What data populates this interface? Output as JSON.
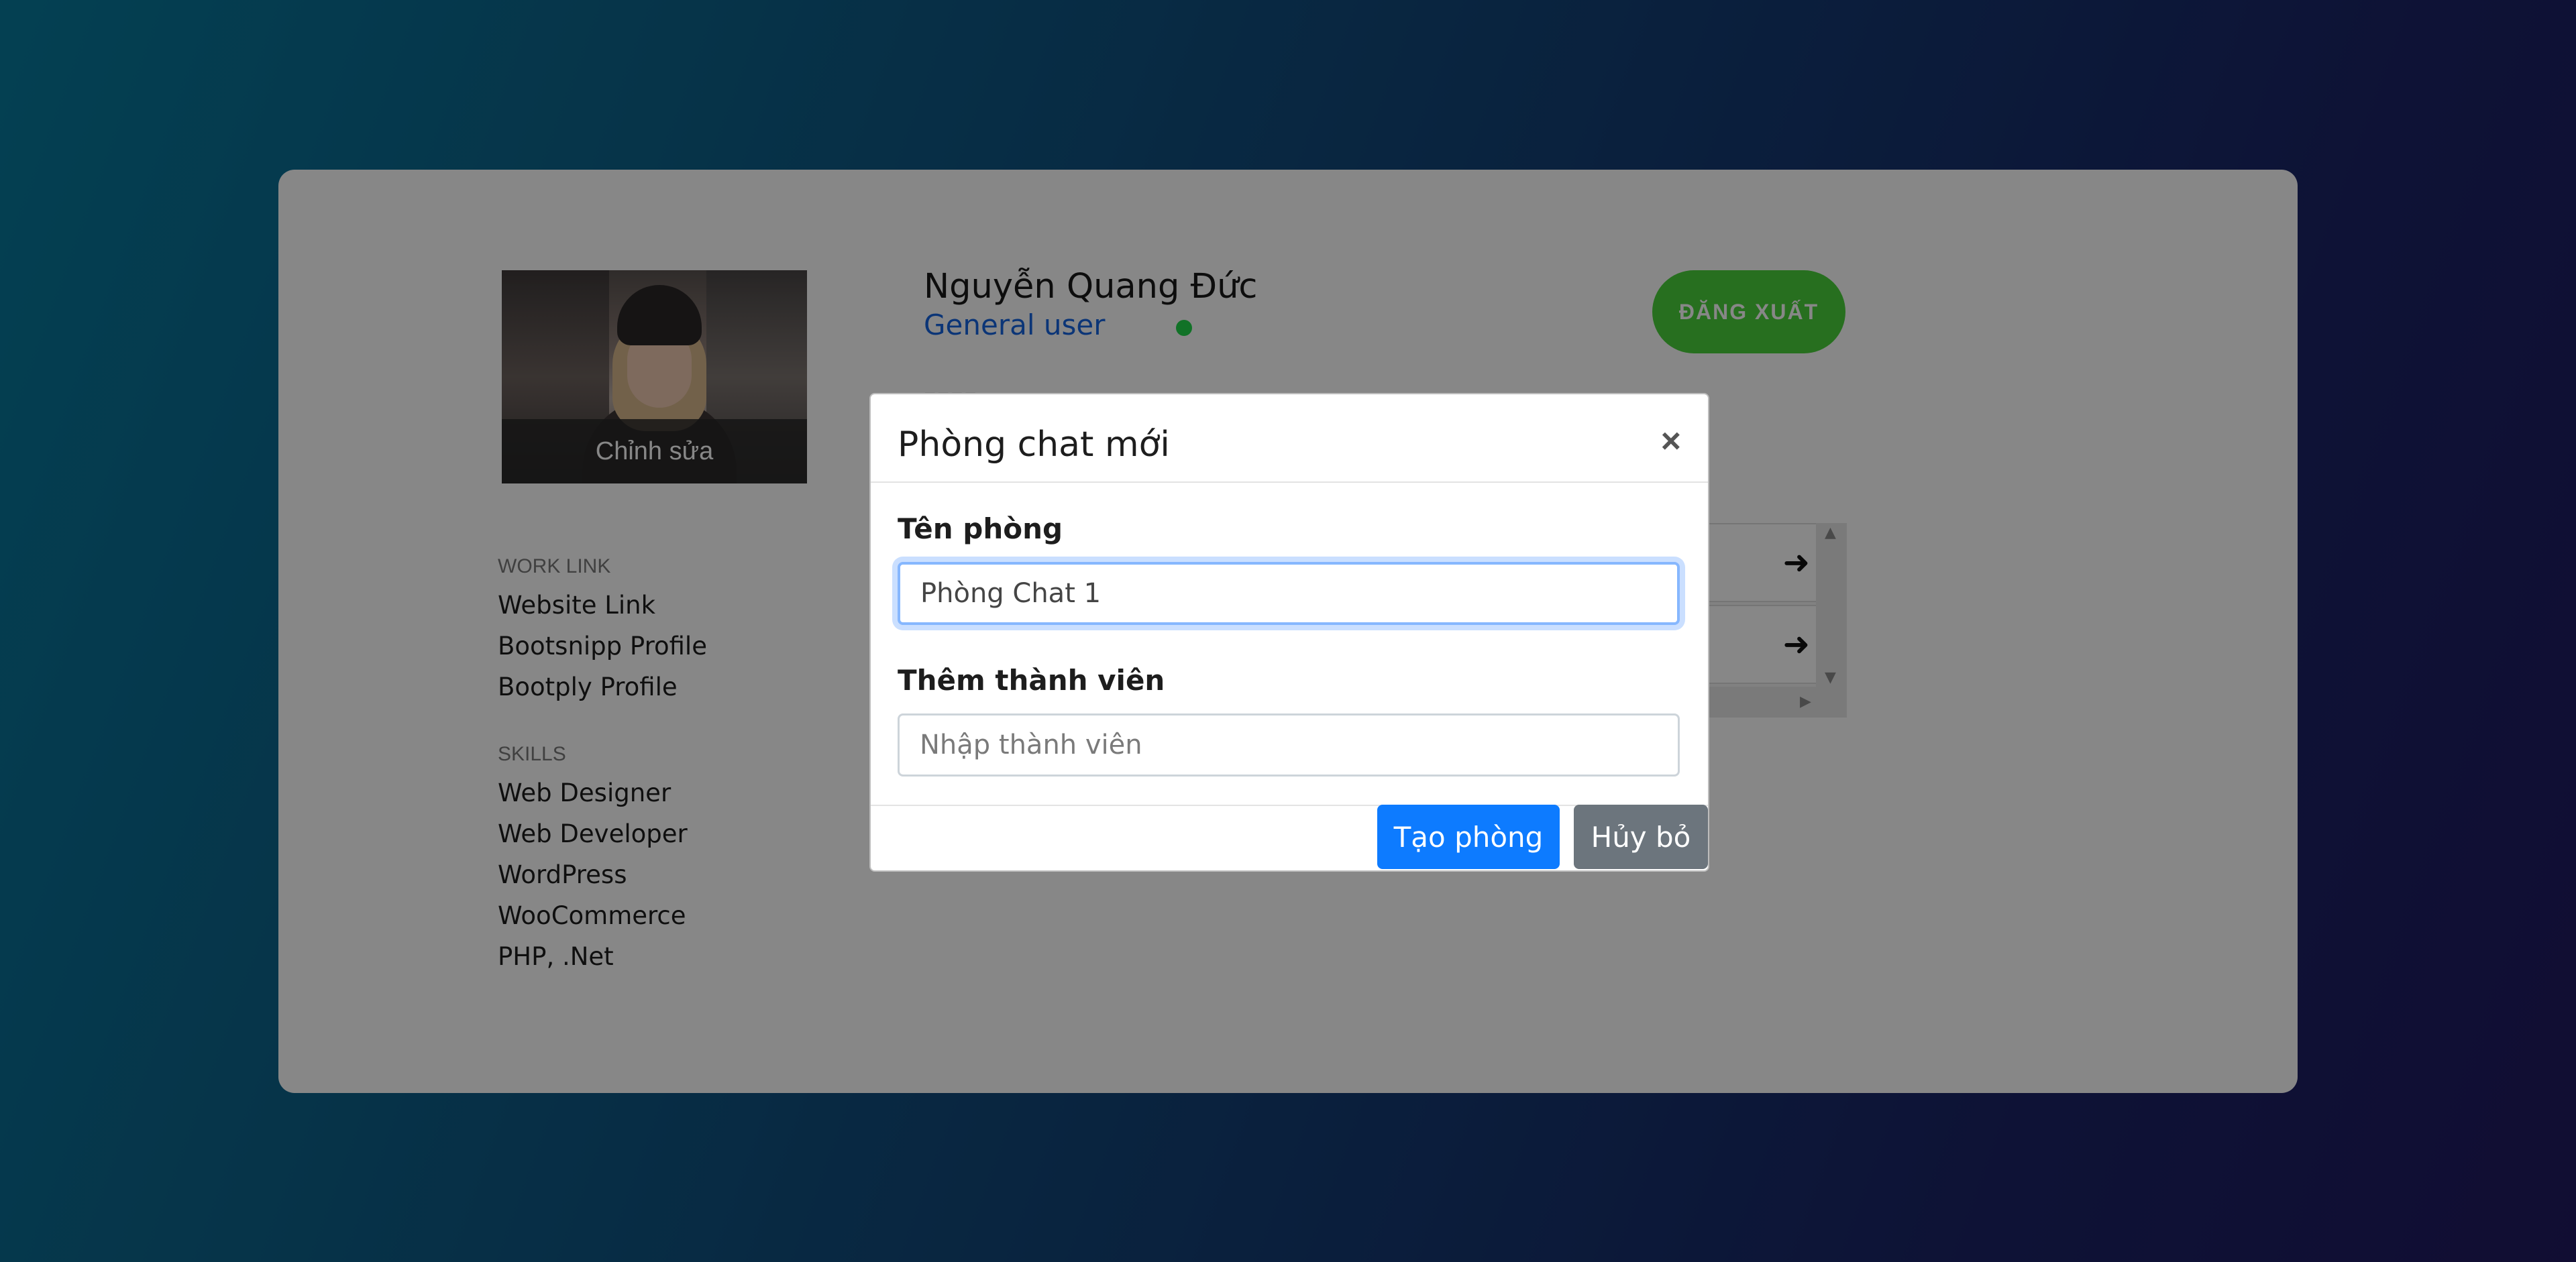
{
  "profile": {
    "photo_edit_label": "Chỉnh sửa",
    "name": "Nguyễn Quang Đức",
    "role": "General user",
    "status_color": "#20d84a",
    "logout_label": "ĐĂNG XUẤT"
  },
  "sidebar": {
    "work_link_title": "WORK LINK",
    "work_links": [
      "Website Link",
      "Bootsnipp Profile",
      "Bootply Profile"
    ],
    "skills_title": "SKILLS",
    "skills": [
      "Web Designer",
      "Web Developer",
      "WordPress",
      "WooCommerce",
      "PHP, .Net"
    ]
  },
  "rooms": {
    "items": [
      {
        "arrow": "➜"
      },
      {
        "arrow": "➜"
      }
    ]
  },
  "modal": {
    "title": "Phòng chat mới",
    "close_glyph": "×",
    "room_name_label": "Tên phòng",
    "room_name_value": "Phòng Chat 1",
    "members_label": "Thêm thành viên",
    "members_placeholder": "Nhập thành viên",
    "create_button": "Tạo phòng",
    "cancel_button": "Hủy bỏ"
  },
  "colors": {
    "primary": "#0d7bff",
    "secondary": "#6c757d",
    "logout_green": "#4ad23c",
    "role_blue": "#1565e0"
  }
}
